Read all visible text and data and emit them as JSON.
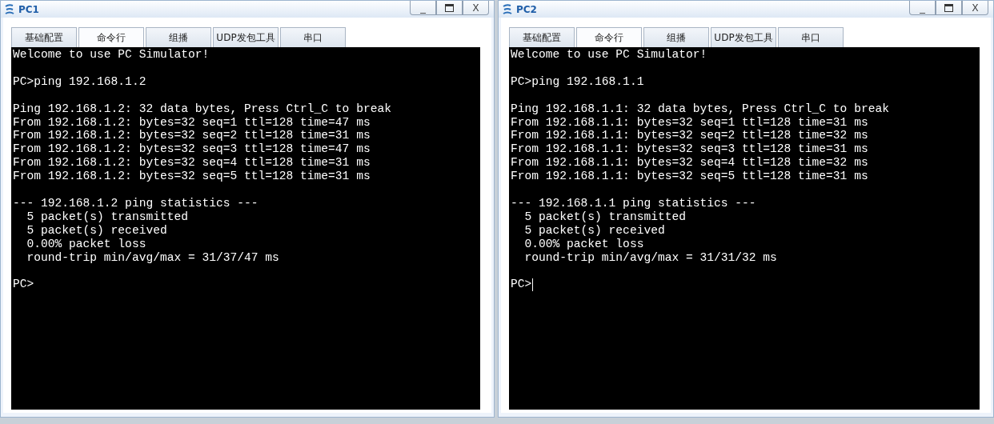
{
  "windows": [
    {
      "title": "PC1",
      "controls": [
        "_",
        "X"
      ],
      "tabs": [
        {
          "label": "基础配置",
          "selected": false
        },
        {
          "label": "命令行",
          "selected": true
        },
        {
          "label": "组播",
          "selected": false
        },
        {
          "label": "UDP发包工具",
          "selected": false
        },
        {
          "label": "串口",
          "selected": false
        }
      ],
      "terminal": {
        "cursor": false,
        "blocks": [
          [
            "Welcome to use PC Simulator!"
          ],
          [
            "PC>ping 192.168.1.2"
          ],
          [
            "Ping 192.168.1.2: 32 data bytes, Press Ctrl_C to break",
            "From 192.168.1.2: bytes=32 seq=1 ttl=128 time=47 ms",
            "From 192.168.1.2: bytes=32 seq=2 ttl=128 time=31 ms",
            "From 192.168.1.2: bytes=32 seq=3 ttl=128 time=47 ms",
            "From 192.168.1.2: bytes=32 seq=4 ttl=128 time=31 ms",
            "From 192.168.1.2: bytes=32 seq=5 ttl=128 time=31 ms"
          ],
          [
            "--- 192.168.1.2 ping statistics ---",
            "  5 packet(s) transmitted",
            "  5 packet(s) received",
            "  0.00% packet loss",
            "  round-trip min/avg/max = 31/37/47 ms"
          ],
          [
            "PC>"
          ]
        ]
      }
    },
    {
      "title": "PC2",
      "controls": [
        "_",
        "X"
      ],
      "tabs": [
        {
          "label": "基础配置",
          "selected": false
        },
        {
          "label": "命令行",
          "selected": true
        },
        {
          "label": "组播",
          "selected": false
        },
        {
          "label": "UDP发包工具",
          "selected": false
        },
        {
          "label": "串口",
          "selected": false
        }
      ],
      "terminal": {
        "cursor": true,
        "blocks": [
          [
            "Welcome to use PC Simulator!"
          ],
          [
            "PC>ping 192.168.1.1"
          ],
          [
            "Ping 192.168.1.1: 32 data bytes, Press Ctrl_C to break",
            "From 192.168.1.1: bytes=32 seq=1 ttl=128 time=31 ms",
            "From 192.168.1.1: bytes=32 seq=2 ttl=128 time=32 ms",
            "From 192.168.1.1: bytes=32 seq=3 ttl=128 time=31 ms",
            "From 192.168.1.1: bytes=32 seq=4 ttl=128 time=32 ms",
            "From 192.168.1.1: bytes=32 seq=5 ttl=128 time=31 ms"
          ],
          [
            "--- 192.168.1.1 ping statistics ---",
            "  5 packet(s) transmitted",
            "  5 packet(s) received",
            "  0.00% packet loss",
            "  round-trip min/avg/max = 31/31/32 ms"
          ],
          [
            "PC>"
          ]
        ]
      }
    }
  ]
}
